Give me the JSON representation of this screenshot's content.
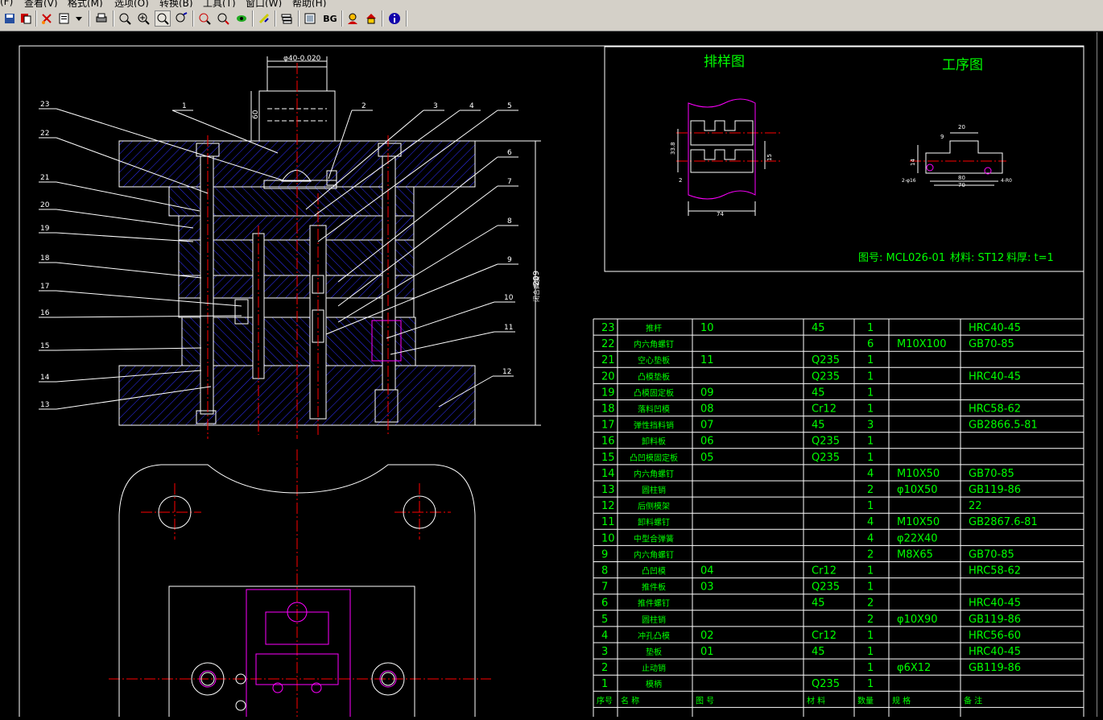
{
  "menu": [
    "(F)",
    "查看(V)",
    "格式(M)",
    "选项(O)",
    "转换(B)",
    "工具(T)",
    "窗口(W)",
    "帮助(H)"
  ],
  "toolbar": {
    "bg_label": "BG"
  },
  "drawing": {
    "dim_top": "φ40-0.020",
    "dim_60": "60",
    "dim_209": "209",
    "dim_209_prefix": "闭合高度",
    "callouts_left": [
      "23",
      "22",
      "21",
      "20",
      "19",
      "18",
      "17",
      "16",
      "15",
      "14",
      "13"
    ],
    "callouts_right": [
      "1",
      "2",
      "3",
      "4",
      "5",
      "6",
      "7",
      "8",
      "9",
      "10",
      "11",
      "12"
    ],
    "strip_title": "排样图",
    "process_title": "工序图",
    "strip_dims": [
      "33.8",
      "74",
      "15",
      "2"
    ],
    "process_dims": [
      "20",
      "9",
      "80",
      "70",
      "2-φ16",
      "4-R0",
      "14"
    ],
    "info": {
      "drawing_no": "图号: MCL026-01",
      "material": "材料: ST12",
      "thickness": "料厚: t=1"
    }
  },
  "bom": {
    "rows": [
      {
        "no": "23",
        "name": "推杆",
        "code": "10",
        "mat": "45",
        "qty": "1",
        "spec": "",
        "remark": "HRC40-45"
      },
      {
        "no": "22",
        "name": "内六角螺钉",
        "code": "",
        "mat": "",
        "qty": "6",
        "spec": "M10X100",
        "remark": "GB70-85"
      },
      {
        "no": "21",
        "name": "空心垫板",
        "code": "11",
        "mat": "Q235",
        "qty": "1",
        "spec": "",
        "remark": ""
      },
      {
        "no": "20",
        "name": "凸模垫板",
        "code": "",
        "mat": "Q235",
        "qty": "1",
        "spec": "",
        "remark": "HRC40-45"
      },
      {
        "no": "19",
        "name": "凸模固定板",
        "code": "09",
        "mat": "45",
        "qty": "1",
        "spec": "",
        "remark": ""
      },
      {
        "no": "18",
        "name": "落料凹模",
        "code": "08",
        "mat": "Cr12",
        "qty": "1",
        "spec": "",
        "remark": "HRC58-62"
      },
      {
        "no": "17",
        "name": "弹性挡料销",
        "code": "07",
        "mat": "45",
        "qty": "3",
        "spec": "",
        "remark": "GB2866.5-81"
      },
      {
        "no": "16",
        "name": "卸料板",
        "code": "06",
        "mat": "Q235",
        "qty": "1",
        "spec": "",
        "remark": ""
      },
      {
        "no": "15",
        "name": "凸凹模固定板",
        "code": "05",
        "mat": "Q235",
        "qty": "1",
        "spec": "",
        "remark": ""
      },
      {
        "no": "14",
        "name": "内六角螺钉",
        "code": "",
        "mat": "",
        "qty": "4",
        "spec": "M10X50",
        "remark": "GB70-85"
      },
      {
        "no": "13",
        "name": "圆柱销",
        "code": "",
        "mat": "",
        "qty": "2",
        "spec": "φ10X50",
        "remark": "GB119-86"
      },
      {
        "no": "12",
        "name": "后侧模架",
        "code": "",
        "mat": "",
        "qty": "1",
        "spec": "",
        "remark": "22"
      },
      {
        "no": "11",
        "name": "卸料螺钉",
        "code": "",
        "mat": "",
        "qty": "4",
        "spec": "M10X50",
        "remark": "GB2867.6-81"
      },
      {
        "no": "10",
        "name": "中型合弹簧",
        "code": "",
        "mat": "",
        "qty": "4",
        "spec": "φ22X40",
        "remark": ""
      },
      {
        "no": "9",
        "name": "内六角螺钉",
        "code": "",
        "mat": "",
        "qty": "2",
        "spec": "M8X65",
        "remark": "GB70-85"
      },
      {
        "no": "8",
        "name": "凸凹模",
        "code": "04",
        "mat": "Cr12",
        "qty": "1",
        "spec": "",
        "remark": "HRC58-62"
      },
      {
        "no": "7",
        "name": "推件板",
        "code": "03",
        "mat": "Q235",
        "qty": "1",
        "spec": "",
        "remark": ""
      },
      {
        "no": "6",
        "name": "推件螺钉",
        "code": "",
        "mat": "45",
        "qty": "2",
        "spec": "",
        "remark": "HRC40-45"
      },
      {
        "no": "5",
        "name": "圆柱销",
        "code": "",
        "mat": "",
        "qty": "2",
        "spec": "φ10X90",
        "remark": "GB119-86"
      },
      {
        "no": "4",
        "name": "冲孔凸模",
        "code": "02",
        "mat": "Cr12",
        "qty": "1",
        "spec": "",
        "remark": "HRC56-60"
      },
      {
        "no": "3",
        "name": "垫板",
        "code": "01",
        "mat": "45",
        "qty": "1",
        "spec": "",
        "remark": "HRC40-45"
      },
      {
        "no": "2",
        "name": "止动销",
        "code": "",
        "mat": "",
        "qty": "1",
        "spec": "φ6X12",
        "remark": "GB119-86"
      },
      {
        "no": "1",
        "name": "模柄",
        "code": "",
        "mat": "Q235",
        "qty": "1",
        "spec": "",
        "remark": ""
      }
    ],
    "header": {
      "no": "序号",
      "name": "名    称",
      "code": "图    号",
      "mat": "材    料",
      "qty": "数量",
      "spec": "规    格",
      "remark": "备    注"
    }
  },
  "colors": {
    "background": "#000000",
    "lines": "#ffffff",
    "text": "#00ff00",
    "centerline": "#ff0000",
    "hatch": "#3030ff",
    "magenta": "#ff00ff",
    "toolbar": "#d4d0c8"
  }
}
